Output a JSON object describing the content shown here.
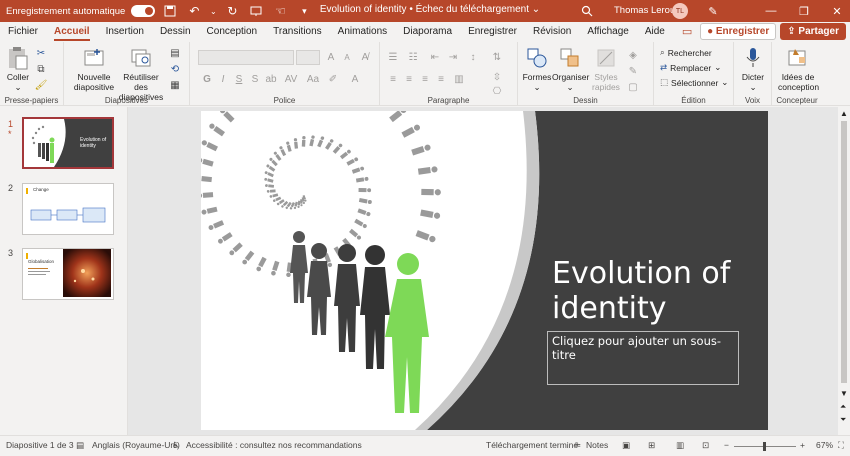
{
  "titlebar": {
    "autosave_label": "Enregistrement automatique",
    "doc_title": "Evolution of identity • Échec du téléchargement ⌄",
    "user_name": "Thomas Leroux",
    "user_initials": "TL"
  },
  "tabs": [
    "Fichier",
    "Accueil",
    "Insertion",
    "Dessin",
    "Conception",
    "Transitions",
    "Animations",
    "Diaporama",
    "Enregistrer",
    "Révision",
    "Affichage",
    "Aide"
  ],
  "tabs_right": {
    "save": "Enregistrer",
    "share": "Partager"
  },
  "ribbon": {
    "clipboard": {
      "paste": "Coller",
      "label": "Presse-papiers"
    },
    "slides": {
      "new_slide": "Nouvelle diapositive",
      "reuse": "Réutiliser des diapositives",
      "label": "Diapositives"
    },
    "font": {
      "label": "Police",
      "bold": "G",
      "italic": "I",
      "underline": "S",
      "shadow": "S"
    },
    "paragraph": {
      "label": "Paragraphe"
    },
    "drawing": {
      "shapes": "Formes",
      "arrange": "Organiser",
      "styles": "Styles rapides",
      "label": "Dessin"
    },
    "editing": {
      "find": "Rechercher",
      "replace": "Remplacer",
      "select": "Sélectionner",
      "label": "Édition"
    },
    "voice": {
      "dictate": "Dicter",
      "label": "Voix"
    },
    "designer": {
      "ideas": "Idées de conception",
      "label": "Concepteur"
    }
  },
  "thumbnails": [
    {
      "num": "1",
      "title": "Evolution of identity",
      "selected": true
    },
    {
      "num": "2",
      "title": "Change",
      "selected": false
    },
    {
      "num": "3",
      "title": "Globalisation",
      "selected": false
    }
  ],
  "slide": {
    "title": "Evolution of identity",
    "subtitle_placeholder": "Cliquez pour ajouter un sous-titre"
  },
  "status": {
    "slide_count": "Diapositive 1 de 3",
    "language": "Anglais (Royaume-Uni)",
    "accessibility": "Accessibilité : consultez nos recommandations",
    "upload": "Téléchargement terminé",
    "notes": "Notes",
    "zoom": "67%"
  },
  "colors": {
    "accent": "#b7472a",
    "slide_dark": "#404040",
    "figure_green": "#7ed957"
  }
}
